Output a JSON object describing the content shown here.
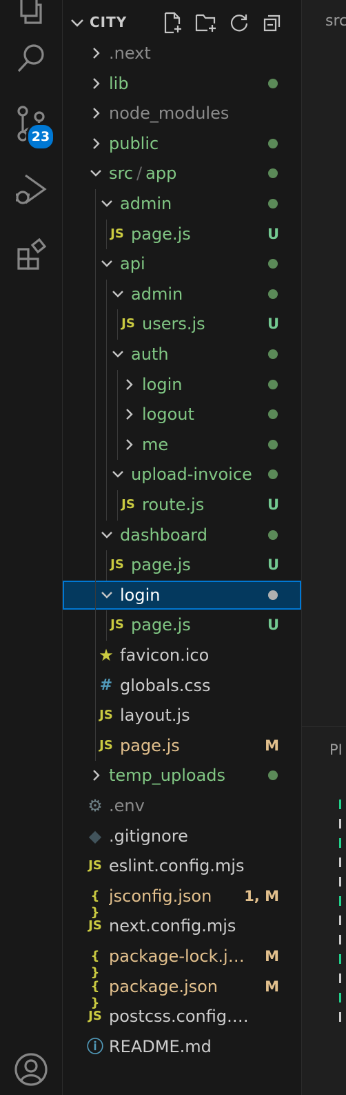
{
  "activity_bar": {
    "items": [
      {
        "name": "explorer-icon"
      },
      {
        "name": "search-icon"
      },
      {
        "name": "source-control-icon"
      },
      {
        "name": "run-debug-icon"
      },
      {
        "name": "extensions-icon"
      },
      {
        "name": "account-icon"
      }
    ],
    "source_control_badge": "23"
  },
  "explorer": {
    "root_title": "CITY",
    "header_actions": [
      "new-file-icon",
      "new-folder-icon",
      "refresh-icon",
      "collapse-all-icon"
    ],
    "rows": [
      {
        "label": ".next",
        "kind": "folder",
        "depth": 0,
        "expanded": false,
        "color": "#8b8b8b"
      },
      {
        "label": "lib",
        "kind": "folder",
        "depth": 0,
        "expanded": false,
        "color": "#81c784",
        "dot": "#5b8a58"
      },
      {
        "label": "node_modules",
        "kind": "folder",
        "depth": 0,
        "expanded": false,
        "color": "#8b8b8b"
      },
      {
        "label": "public",
        "kind": "folder",
        "depth": 0,
        "expanded": false,
        "color": "#81c784",
        "dot": "#5b8a58"
      },
      {
        "label": "src",
        "label2": "app",
        "kind": "folder",
        "depth": 0,
        "expanded": true,
        "color": "#81c784",
        "dot": "#5b8a58"
      },
      {
        "label": "admin",
        "kind": "folder",
        "depth": 1,
        "expanded": true,
        "color": "#81c784",
        "dot": "#5b8a58"
      },
      {
        "label": "page.js",
        "kind": "js",
        "depth": 2,
        "color": "#81c784",
        "status": "U"
      },
      {
        "label": "api",
        "kind": "folder",
        "depth": 1,
        "expanded": true,
        "color": "#81c784",
        "dot": "#5b8a58"
      },
      {
        "label": "admin",
        "kind": "folder",
        "depth": 2,
        "expanded": true,
        "color": "#81c784",
        "dot": "#5b8a58"
      },
      {
        "label": "users.js",
        "kind": "js",
        "depth": 3,
        "color": "#81c784",
        "status": "U"
      },
      {
        "label": "auth",
        "kind": "folder",
        "depth": 2,
        "expanded": true,
        "color": "#81c784",
        "dot": "#5b8a58"
      },
      {
        "label": "login",
        "kind": "folder",
        "depth": 3,
        "expanded": false,
        "color": "#81c784",
        "dot": "#5b8a58"
      },
      {
        "label": "logout",
        "kind": "folder",
        "depth": 3,
        "expanded": false,
        "color": "#81c784",
        "dot": "#5b8a58"
      },
      {
        "label": "me",
        "kind": "folder",
        "depth": 3,
        "expanded": false,
        "color": "#81c784",
        "dot": "#5b8a58"
      },
      {
        "label": "upload-invoice",
        "kind": "folder",
        "depth": 2,
        "expanded": true,
        "color": "#81c784",
        "dot": "#5b8a58"
      },
      {
        "label": "route.js",
        "kind": "js",
        "depth": 3,
        "color": "#81c784",
        "status": "U"
      },
      {
        "label": "dashboard",
        "kind": "folder",
        "depth": 1,
        "expanded": true,
        "color": "#81c784",
        "dot": "#5b8a58"
      },
      {
        "label": "page.js",
        "kind": "js",
        "depth": 2,
        "color": "#81c784",
        "status": "U"
      },
      {
        "label": "login",
        "kind": "folder",
        "depth": 1,
        "expanded": true,
        "color": "#ffffff",
        "dot": "#b0b0b0",
        "selected": true
      },
      {
        "label": "page.js",
        "kind": "js",
        "depth": 2,
        "color": "#81c784",
        "status": "U"
      },
      {
        "label": "favicon.ico",
        "kind": "star",
        "depth": 1,
        "color": "#cccccc"
      },
      {
        "label": "globals.css",
        "kind": "css",
        "depth": 1,
        "color": "#cccccc"
      },
      {
        "label": "layout.js",
        "kind": "js",
        "depth": 1,
        "color": "#cccccc"
      },
      {
        "label": "page.js",
        "kind": "js",
        "depth": 1,
        "color": "#e2c08d",
        "status": "M"
      },
      {
        "label": "temp_uploads",
        "kind": "folder",
        "depth": 0,
        "expanded": false,
        "color": "#81c784",
        "dot": "#5b8a58"
      },
      {
        "label": ".env",
        "kind": "gear",
        "depth": 0,
        "color": "#8b8b8b"
      },
      {
        "label": ".gitignore",
        "kind": "git",
        "depth": 0,
        "color": "#cccccc"
      },
      {
        "label": "eslint.config.mjs",
        "kind": "js",
        "depth": 0,
        "color": "#cccccc"
      },
      {
        "label": "jsconfig.json",
        "kind": "json",
        "depth": 0,
        "color": "#e2c08d",
        "status": "1, M",
        "status_color": "#e2c08d"
      },
      {
        "label": "next.config.mjs",
        "kind": "js",
        "depth": 0,
        "color": "#cccccc"
      },
      {
        "label": "package-lock.js...",
        "kind": "json",
        "depth": 0,
        "color": "#e2c08d",
        "status": "M"
      },
      {
        "label": "package.json",
        "kind": "json",
        "depth": 0,
        "color": "#e2c08d",
        "status": "M"
      },
      {
        "label": "postcss.config.mjs",
        "kind": "js",
        "depth": 0,
        "color": "#cccccc"
      },
      {
        "label": "README.md",
        "kind": "info",
        "depth": 0,
        "color": "#cccccc"
      }
    ]
  },
  "editor_edge": {
    "tab_fragment": "src",
    "panel_fragment": "PI"
  },
  "colors": {
    "js_icon": "#cbcb41",
    "json_icon": "#cbcb41",
    "css_icon": "#519aba",
    "star_icon": "#cbcb41",
    "info_icon": "#519aba",
    "gear_icon": "#6d8086",
    "git_icon": "#41535b",
    "status_u": "#73c991",
    "status_m": "#e2c08d"
  }
}
